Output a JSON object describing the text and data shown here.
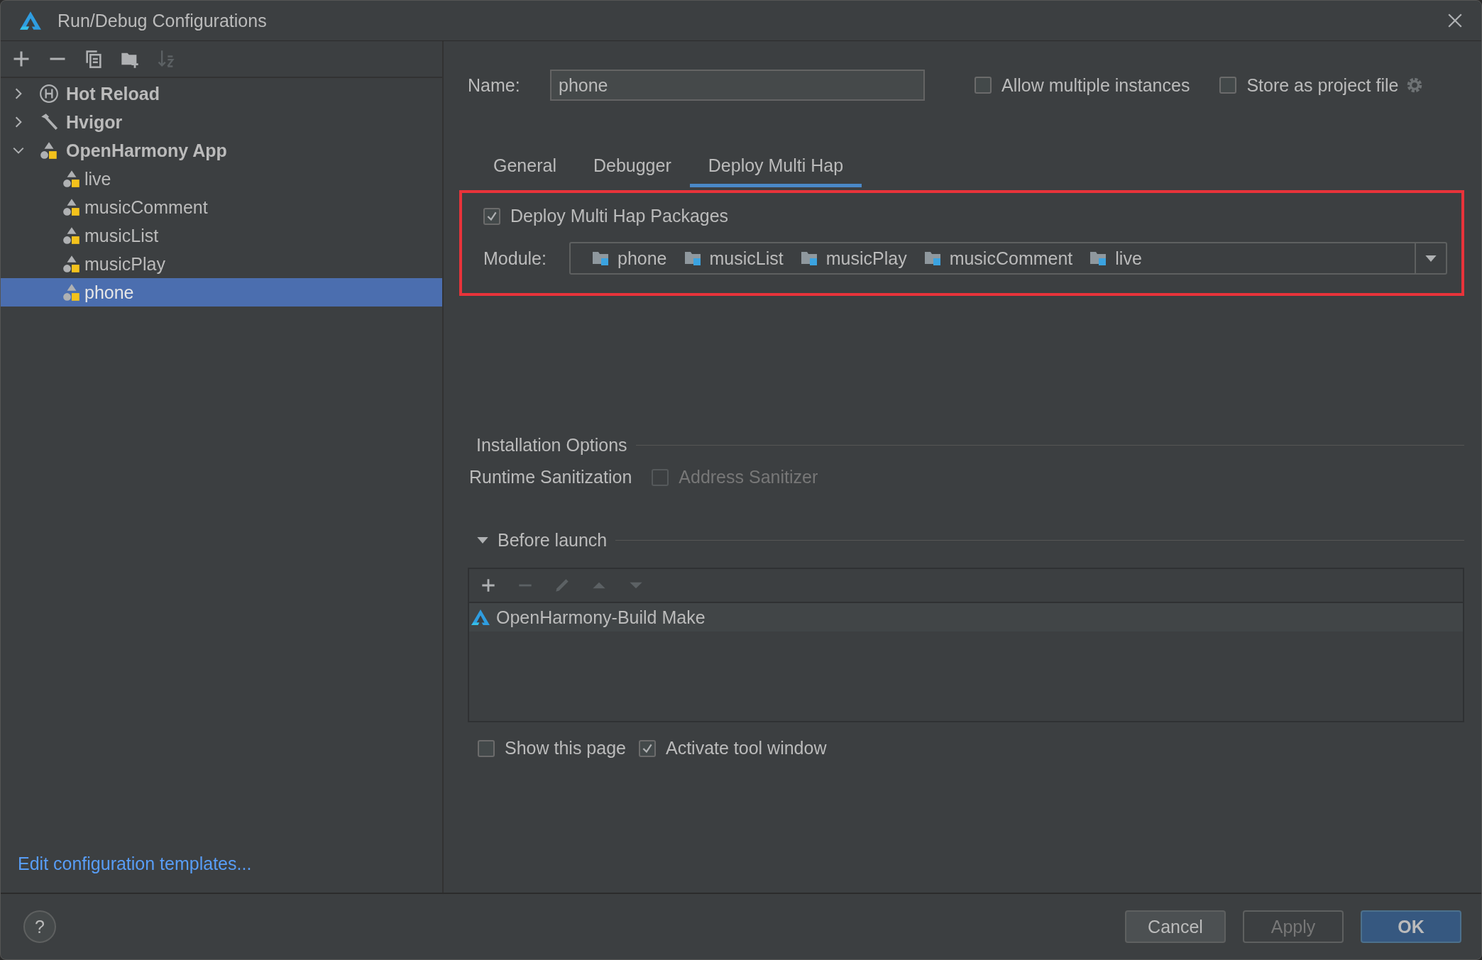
{
  "window": {
    "title": "Run/Debug Configurations"
  },
  "toolbar": [
    {
      "kind": "add",
      "disabled": false
    },
    {
      "kind": "remove",
      "disabled": false
    },
    {
      "kind": "copy",
      "disabled": false
    },
    {
      "kind": "folder",
      "disabled": false
    },
    {
      "kind": "sort",
      "disabled": true
    }
  ],
  "tree": [
    {
      "label": "Hot Reload",
      "kind": "hot-reload",
      "expanded": false,
      "selected": false
    },
    {
      "label": "Hvigor",
      "kind": "hammer",
      "expanded": false,
      "selected": false
    },
    {
      "label": "OpenHarmony App",
      "kind": "app",
      "expanded": true,
      "selected": false,
      "children": [
        {
          "label": "live",
          "kind": "app",
          "selected": false
        },
        {
          "label": "musicComment",
          "kind": "app",
          "selected": false
        },
        {
          "label": "musicList",
          "kind": "app",
          "selected": false
        },
        {
          "label": "musicPlay",
          "kind": "app",
          "selected": false
        },
        {
          "label": "phone",
          "kind": "app",
          "selected": true
        }
      ]
    }
  ],
  "templates_link": "Edit configuration templates...",
  "name": {
    "label": "Name:",
    "value": "phone"
  },
  "options": [
    {
      "label": "Allow multiple instances",
      "checked": false
    },
    {
      "label": "Store as project file",
      "checked": false
    }
  ],
  "tabs": [
    {
      "label": "General",
      "selected": false
    },
    {
      "label": "Debugger",
      "selected": false
    },
    {
      "label": "Deploy Multi Hap",
      "selected": true
    }
  ],
  "deploy": {
    "label": "Deploy Multi Hap Packages",
    "checked": true,
    "module_label": "Module:",
    "modules": [
      "phone",
      "musicList",
      "musicPlay",
      "musicComment",
      "live"
    ]
  },
  "installation": {
    "title": "Installation Options",
    "runtime_label": "Runtime Sanitization",
    "sanitizer": {
      "label": "Address Sanitizer",
      "checked": false,
      "disabled": true
    }
  },
  "before_launch": {
    "title": "Before launch",
    "expanded": true,
    "tools": [
      {
        "kind": "add",
        "disabled": false
      },
      {
        "kind": "remove",
        "disabled": true
      },
      {
        "kind": "edit",
        "disabled": true
      },
      {
        "kind": "up",
        "disabled": true
      },
      {
        "kind": "down",
        "disabled": true
      }
    ],
    "tasks": [
      {
        "label": "OpenHarmony-Build Make",
        "selected": true
      }
    ]
  },
  "bottom_options": [
    {
      "label": "Show this page",
      "checked": false
    },
    {
      "label": "Activate tool window",
      "checked": true
    }
  ],
  "help": "?",
  "buttons": [
    {
      "label": "Cancel",
      "kind": "normal"
    },
    {
      "label": "Apply",
      "kind": "disabled"
    },
    {
      "label": "OK",
      "kind": "default"
    }
  ]
}
